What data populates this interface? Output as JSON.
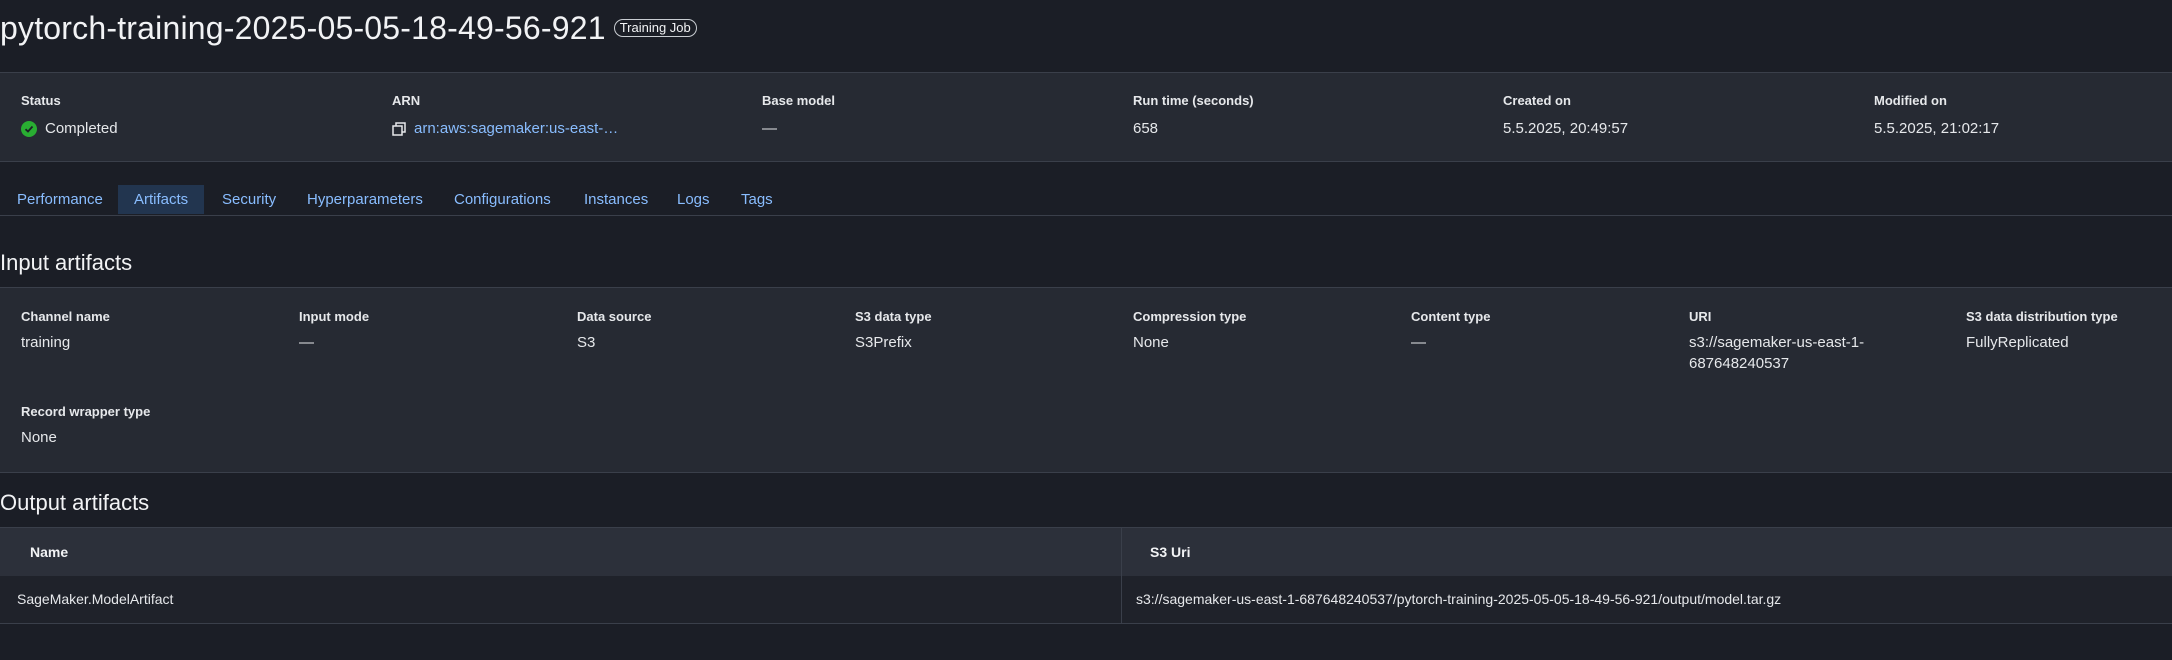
{
  "header": {
    "title": "pytorch-training-2025-05-05-18-49-56-921",
    "badge": "Training Job"
  },
  "summary": {
    "status": {
      "label": "Status",
      "value": "Completed",
      "icon": "check-circle-icon",
      "color": "#29ad32"
    },
    "arn": {
      "label": "ARN",
      "value": "arn:aws:sagemaker:us-east-…",
      "icon": "copy-icon"
    },
    "base_model": {
      "label": "Base model",
      "value": "—"
    },
    "run_time": {
      "label": "Run time (seconds)",
      "value": "658"
    },
    "created_on": {
      "label": "Created on",
      "value": "5.5.2025, 20:49:57"
    },
    "modified_on": {
      "label": "Modified on",
      "value": "5.5.2025, 21:02:17"
    }
  },
  "tabs": [
    {
      "label": "Performance"
    },
    {
      "label": "Artifacts",
      "active": true
    },
    {
      "label": "Security"
    },
    {
      "label": "Hyperparameters"
    },
    {
      "label": "Configurations"
    },
    {
      "label": "Instances"
    },
    {
      "label": "Logs"
    },
    {
      "label": "Tags"
    }
  ],
  "input_artifacts": {
    "title": "Input artifacts",
    "fields": [
      {
        "label": "Channel name",
        "value": "training"
      },
      {
        "label": "Input mode",
        "value": "—"
      },
      {
        "label": "Data source",
        "value": "S3"
      },
      {
        "label": "S3 data type",
        "value": "S3Prefix"
      },
      {
        "label": "Compression type",
        "value": "None"
      },
      {
        "label": "Content type",
        "value": "—"
      },
      {
        "label": "URI",
        "value": "s3://sagemaker-us-east-1-687648240537"
      },
      {
        "label": "S3 data distribution type",
        "value": "FullyReplicated"
      },
      {
        "label": "Record wrapper type",
        "value": "None"
      }
    ]
  },
  "output_artifacts": {
    "title": "Output artifacts",
    "columns": [
      "Name",
      "S3 Uri"
    ],
    "rows": [
      [
        "SageMaker.ModelArtifact",
        "s3://sagemaker-us-east-1-687648240537/pytorch-training-2025-05-05-18-49-56-921/output/model.tar.gz"
      ]
    ]
  },
  "colors": {
    "background": "#1b1e26",
    "card": "#262a33",
    "link": "#89bdff",
    "active_tab": "#22354f",
    "success": "#29ad32"
  }
}
